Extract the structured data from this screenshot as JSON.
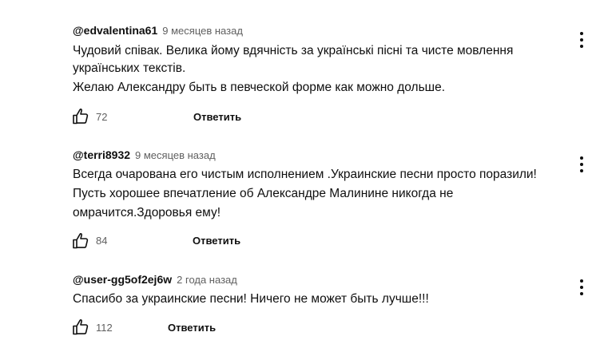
{
  "comments": [
    {
      "author": "@edvalentina61",
      "time": "9 месяцев назад",
      "lines": [
        "Чудовий співак. Велика йому вдячність за українські пісні та чисте мовлення",
        "українських текстів.",
        "Желаю Александру быть в певческой форме как можно дольше."
      ],
      "likes": "72",
      "reply_label": "Ответить",
      "like_icon": "thumb-up-icon",
      "menu_icon": "more-vert-icon"
    },
    {
      "author": "@terri8932",
      "time": "9 месяцев назад",
      "lines": [
        "Всегда очарована его чистым исполнением .Украинские песни просто поразили!",
        "Пусть хорошее впечатление об Александре Малинине никогда не",
        "омрачится.Здоровья ему!"
      ],
      "likes": "84",
      "reply_label": "Ответить",
      "like_icon": "thumb-up-icon",
      "menu_icon": "more-vert-icon"
    },
    {
      "author": "@user-gg5of2ej6w",
      "time": "2 года назад",
      "lines": [
        "Спасибо за украинские песни! Ничего не может быть лучше!!!"
      ],
      "likes": "112",
      "reply_label": "Ответить",
      "like_icon": "thumb-up-icon",
      "menu_icon": "more-vert-icon"
    }
  ]
}
